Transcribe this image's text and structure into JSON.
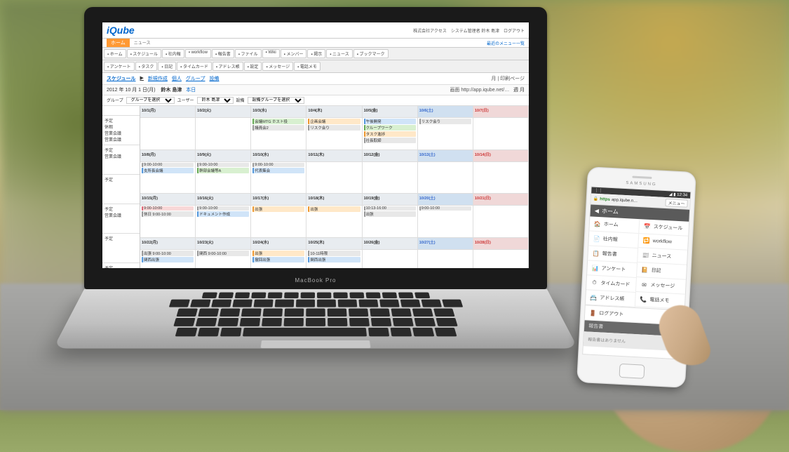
{
  "laptop": {
    "brand": "MacBook Pro",
    "app": {
      "logo": "iQube",
      "header_right": "株式会社アクセス　システム管理者 鈴木 島津　ログアウト",
      "header_menu_link": "最近のメニュー一覧",
      "orange_tab": "ホーム",
      "tab_sub": "ニュース",
      "toolbar": [
        "ホーム",
        "スケジュール",
        "社内報",
        "workflow",
        "報告書",
        "ファイル",
        "Wiki",
        "メンバー",
        "掲示",
        "ニュース",
        "ブックマーク"
      ],
      "toolbar2": [
        "アンケート",
        "タスク",
        "日記",
        "タイムカード",
        "アドレス帳",
        "設定",
        "メッセージ",
        "電話メモ"
      ],
      "breadcrumb": [
        "スケジュール",
        "新規作成",
        "個人",
        "グループ",
        "設備"
      ],
      "breadcrumb_print": "月 | 印刷ページ",
      "date_nav": "2012 年 10 月 1 日(月)",
      "user_label": "鈴木 島津",
      "today_label": "本日",
      "month_nav": "週 月",
      "url_label": "画面 http://app.iqube.net/…",
      "filter": {
        "group_label": "グループ",
        "group_value": "グループを選択",
        "user_label": "ユーザー",
        "user_value": "鈴木 島津",
        "equip_label": "設備",
        "equip_value": "設備グループを選択"
      },
      "side_rows": [
        "予定\n休暇\n営業会議\n営業会議",
        "予定\n営業会議",
        "予定",
        "予定\n営業会議",
        "予定",
        "予定\n営業会議"
      ],
      "day_heads": [
        "10/1(月)",
        "10/2(火)",
        "10/3(水)",
        "10/4(木)",
        "10/5(金)",
        "10/6(土)",
        "10/7(日)"
      ],
      "day_heads2": [
        "10/8(月)",
        "10/9(火)",
        "10/10(水)",
        "10/11(木)",
        "10/12(金)",
        "10/13(土)",
        "10/14(日)"
      ],
      "day_heads3": [
        "10/15(月)",
        "10/16(火)",
        "10/17(水)",
        "10/18(木)",
        "10/19(金)",
        "10/20(土)",
        "10/21(日)"
      ],
      "day_heads4": [
        "10/22(月)",
        "10/23(火)",
        "10/24(水)",
        "10/25(木)",
        "10/26(金)",
        "10/27(土)",
        "10/28(日)"
      ],
      "events": {
        "r1": [
          [],
          [],
          [
            {
              "t": "会議MTG ホスト役",
              "c": "green"
            },
            {
              "t": "議員会2",
              "c": "gray"
            }
          ],
          [
            {
              "t": "企画会議",
              "c": "orange"
            },
            {
              "t": "リスク会り",
              "c": "gray"
            }
          ],
          [
            {
              "t": "午後開発",
              "c": "blue"
            },
            {
              "t": "クループワーク",
              "c": "green"
            },
            {
              "t": "タスク進捗",
              "c": "orange"
            },
            {
              "t": "社長取締",
              "c": "gray"
            }
          ],
          [
            {
              "t": "リスク会り",
              "c": "gray"
            }
          ],
          []
        ],
        "r2": [
          [
            {
              "t": "9:00-10:00",
              "c": "gray"
            },
            {
              "t": "支所長会議",
              "c": "blue"
            }
          ],
          [
            {
              "t": "9:00-10:00",
              "c": "gray"
            },
            {
              "t": "幹部会議等A",
              "c": "green"
            }
          ],
          [
            {
              "t": "9:00-10:00",
              "c": "gray"
            },
            {
              "t": "代表集会",
              "c": "blue"
            }
          ],
          [],
          [],
          [],
          []
        ],
        "r3": [
          [
            {
              "t": "9:00-10:00",
              "c": "pink"
            },
            {
              "t": "休日 9:00-10:00",
              "c": "gray"
            }
          ],
          [
            {
              "t": "9:00-10:00",
              "c": "gray"
            },
            {
              "t": "ドキュメント作成",
              "c": "blue"
            }
          ],
          [
            {
              "t": "出張",
              "c": "orange"
            }
          ],
          [
            {
              "t": "出張",
              "c": "orange"
            }
          ],
          [
            {
              "t": "10:13-16:00",
              "c": "gray"
            },
            {
              "t": "出張",
              "c": "gray"
            }
          ],
          [
            {
              "t": "9:00-10:00",
              "c": "gray"
            }
          ],
          []
        ],
        "r4": [
          [
            {
              "t": "出張 9:00-10:00",
              "c": "gray"
            },
            {
              "t": "関西出張",
              "c": "blue"
            }
          ],
          [
            {
              "t": "関西 9:00-10:00",
              "c": "gray"
            }
          ],
          [
            {
              "t": "出張",
              "c": "orange"
            },
            {
              "t": "撤回出張",
              "c": "blue"
            }
          ],
          [
            {
              "t": "10-11時限",
              "c": "gray"
            },
            {
              "t": "関西出張",
              "c": "blue"
            }
          ],
          [],
          [],
          []
        ]
      }
    }
  },
  "phone": {
    "brand": "SAMSUNG",
    "status_left": "⋮⋮",
    "status_right": "◢ ▮ 12:34",
    "url_prefix": "https",
    "url_text": "app.iqube.n…",
    "menu_btn": "メニュー",
    "nav_back": "◀",
    "nav_title": "ホーム",
    "menu_left": [
      {
        "icon": "🏠",
        "label": "ホーム"
      },
      {
        "icon": "📄",
        "label": "社内報"
      },
      {
        "icon": "📋",
        "label": "報告書"
      },
      {
        "icon": "📊",
        "label": "アンケート"
      },
      {
        "icon": "⏱",
        "label": "タイムカード"
      },
      {
        "icon": "📇",
        "label": "アドレス帳"
      }
    ],
    "menu_right": [
      {
        "icon": "📅",
        "label": "スケジュール"
      },
      {
        "icon": "🔁",
        "label": "workflow"
      },
      {
        "icon": "📰",
        "label": "ニュース"
      },
      {
        "icon": "📔",
        "label": "日記"
      },
      {
        "icon": "✉",
        "label": "メッセージ"
      },
      {
        "icon": "📞",
        "label": "電話メモ"
      }
    ],
    "logout_icon": "🚪",
    "logout_label": "ログアウト",
    "section_head": "報告書",
    "footer_text": "報告書はありません"
  }
}
